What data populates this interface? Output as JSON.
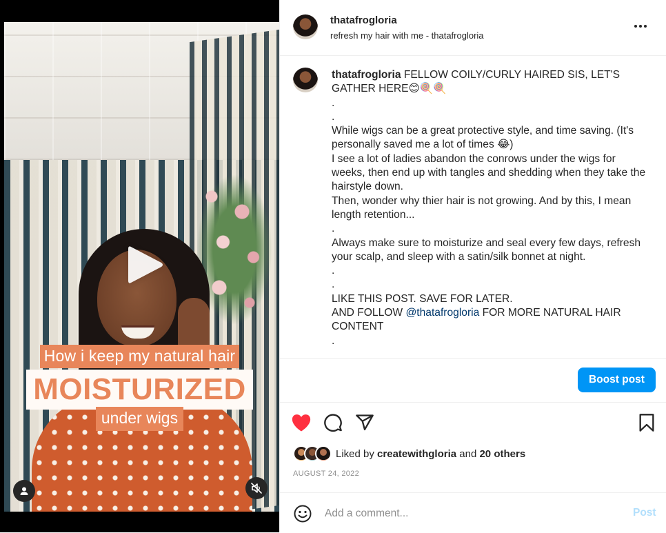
{
  "post": {
    "username": "thatafrogloria",
    "audio": "refresh my hair with me - thatafrogloria",
    "caption_line1": "FELLOW COILY/CURLY HAIRED SIS, LET'S GATHER HERE😊🍭🍭",
    "caption_body_1": ".\n.\nWhile wigs can be a great protective style, and time saving. (It's personally saved me a lot of times 😂)\nI see a lot of ladies abandon the conrows under the wigs for weeks, then end up with tangles and shedding when they take the hairstyle down.\nThen, wonder why thier hair is not growing. And by this, I mean length retention...\n.\nAlways make sure to moisturize and seal every few days, refresh your scalp, and sleep with a satin/silk bonnet at night.\n.\n.\nLIKE THIS POST. SAVE FOR LATER.\nAND FOLLOW ",
    "mention": "@thatafrogloria",
    "caption_body_2": " FOR MORE NATURAL HAIR CONTENT\n.",
    "boost_label": "Boost post",
    "liked_by_prefix": "Liked by ",
    "liked_by_user": "createwithgloria",
    "liked_by_and": " and ",
    "liked_by_others": "20 others",
    "date": "AUGUST 24, 2022",
    "liked": true
  },
  "video": {
    "overlay_line1": "How i keep my natural hair",
    "overlay_line2": "MOISTURIZED",
    "overlay_line3": "under wigs"
  },
  "comment": {
    "placeholder": "Add a comment...",
    "post_label": "Post"
  },
  "icons": {
    "more": "more-horizontal-icon",
    "like": "heart-icon",
    "comment": "comment-icon",
    "share": "share-icon",
    "save": "bookmark-icon",
    "emoji": "emoji-icon",
    "play": "play-icon",
    "user": "user-icon",
    "mute": "muted-speaker-icon"
  },
  "colors": {
    "accent_blue": "#0095f6",
    "like_red": "#ff3040",
    "overlay_orange": "#e8865a"
  }
}
